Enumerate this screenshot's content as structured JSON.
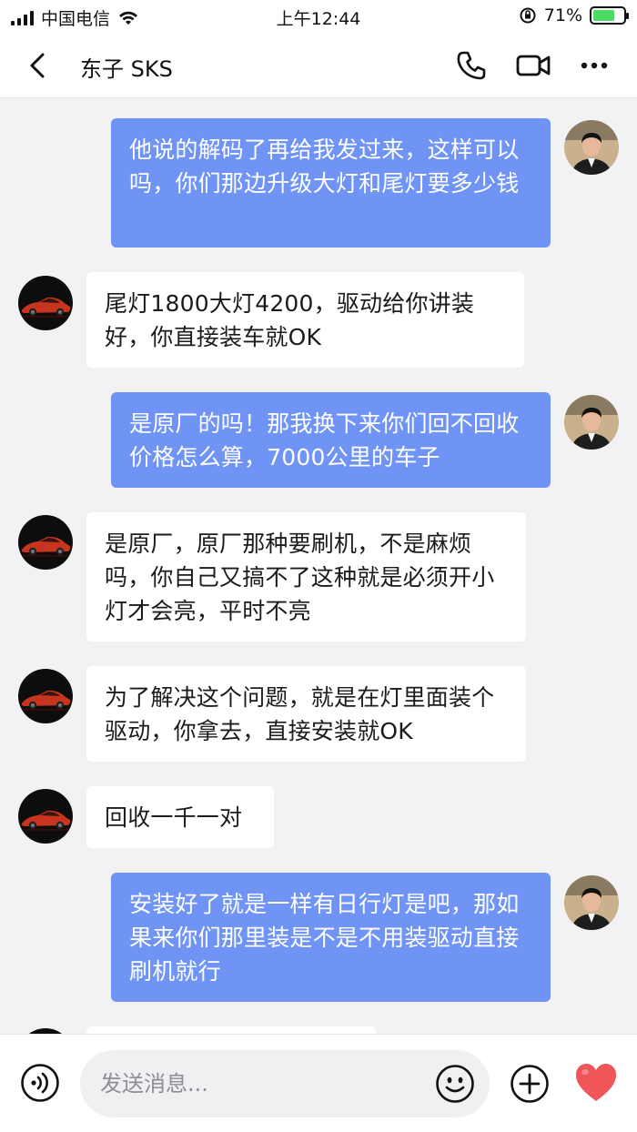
{
  "status_bar": {
    "carrier": "中国电信",
    "time": "上午12:44",
    "battery": "71%",
    "battery_level": 0.71
  },
  "header": {
    "title": "东子 SKS"
  },
  "messages": [
    {
      "side": "out",
      "text": "他说的解码了再给我发过来，这样可以吗，你们那边升级大灯和尾灯要多少钱"
    },
    {
      "side": "in",
      "text": "尾灯1800大灯4200，驱动给你讲装好，你直接装车就OK"
    },
    {
      "side": "out",
      "text": "是原厂的吗！那我换下来你们回不回收价格怎么算，7000公里的车子"
    },
    {
      "side": "in",
      "text": "是原厂，原厂那种要刷机，不是麻烦吗，你自己又搞不了这种就是必须开小灯才会亮，平时不亮"
    },
    {
      "side": "in",
      "text": "为了解决这个问题，就是在灯里面装个驱动，你拿去，直接安装就OK"
    },
    {
      "side": "in",
      "text": "回收一千一对"
    },
    {
      "side": "out",
      "text": "安装好了就是一样有日行灯是吧，那如果来你们那里装是不是不用装驱动直接刷机就行"
    }
  ],
  "input": {
    "placeholder": "发送消息..."
  },
  "colors": {
    "outgoing_bubble": "#6f94f6",
    "incoming_bubble": "#ffffff",
    "background": "#f2f2f5",
    "heart": "#f0555a"
  }
}
